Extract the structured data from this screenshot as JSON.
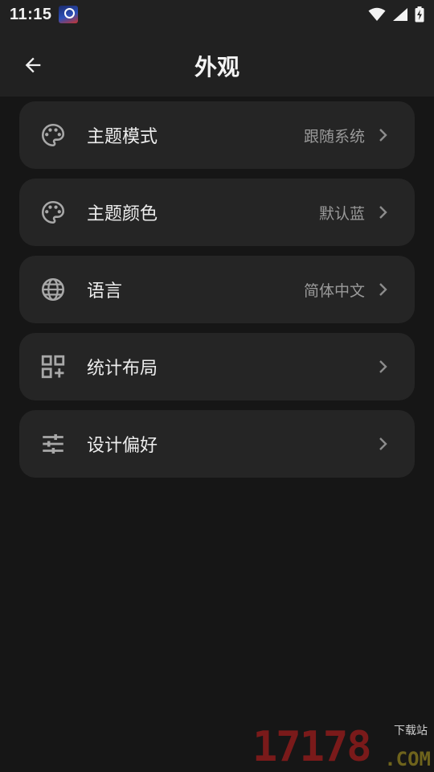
{
  "status_bar": {
    "time": "11:15"
  },
  "header": {
    "title": "外观"
  },
  "settings": [
    {
      "label": "主题模式",
      "value": "跟随系统",
      "icon": "palette-icon"
    },
    {
      "label": "主题颜色",
      "value": "默认蓝",
      "icon": "palette-icon"
    },
    {
      "label": "语言",
      "value": "简体中文",
      "icon": "globe-icon"
    },
    {
      "label": "统计布局",
      "value": "",
      "icon": "grid-add-icon"
    },
    {
      "label": "设计偏好",
      "value": "",
      "icon": "tune-icon"
    }
  ],
  "watermark": {
    "number": "17178",
    "site": "下载站",
    "suffix": ".COM"
  }
}
